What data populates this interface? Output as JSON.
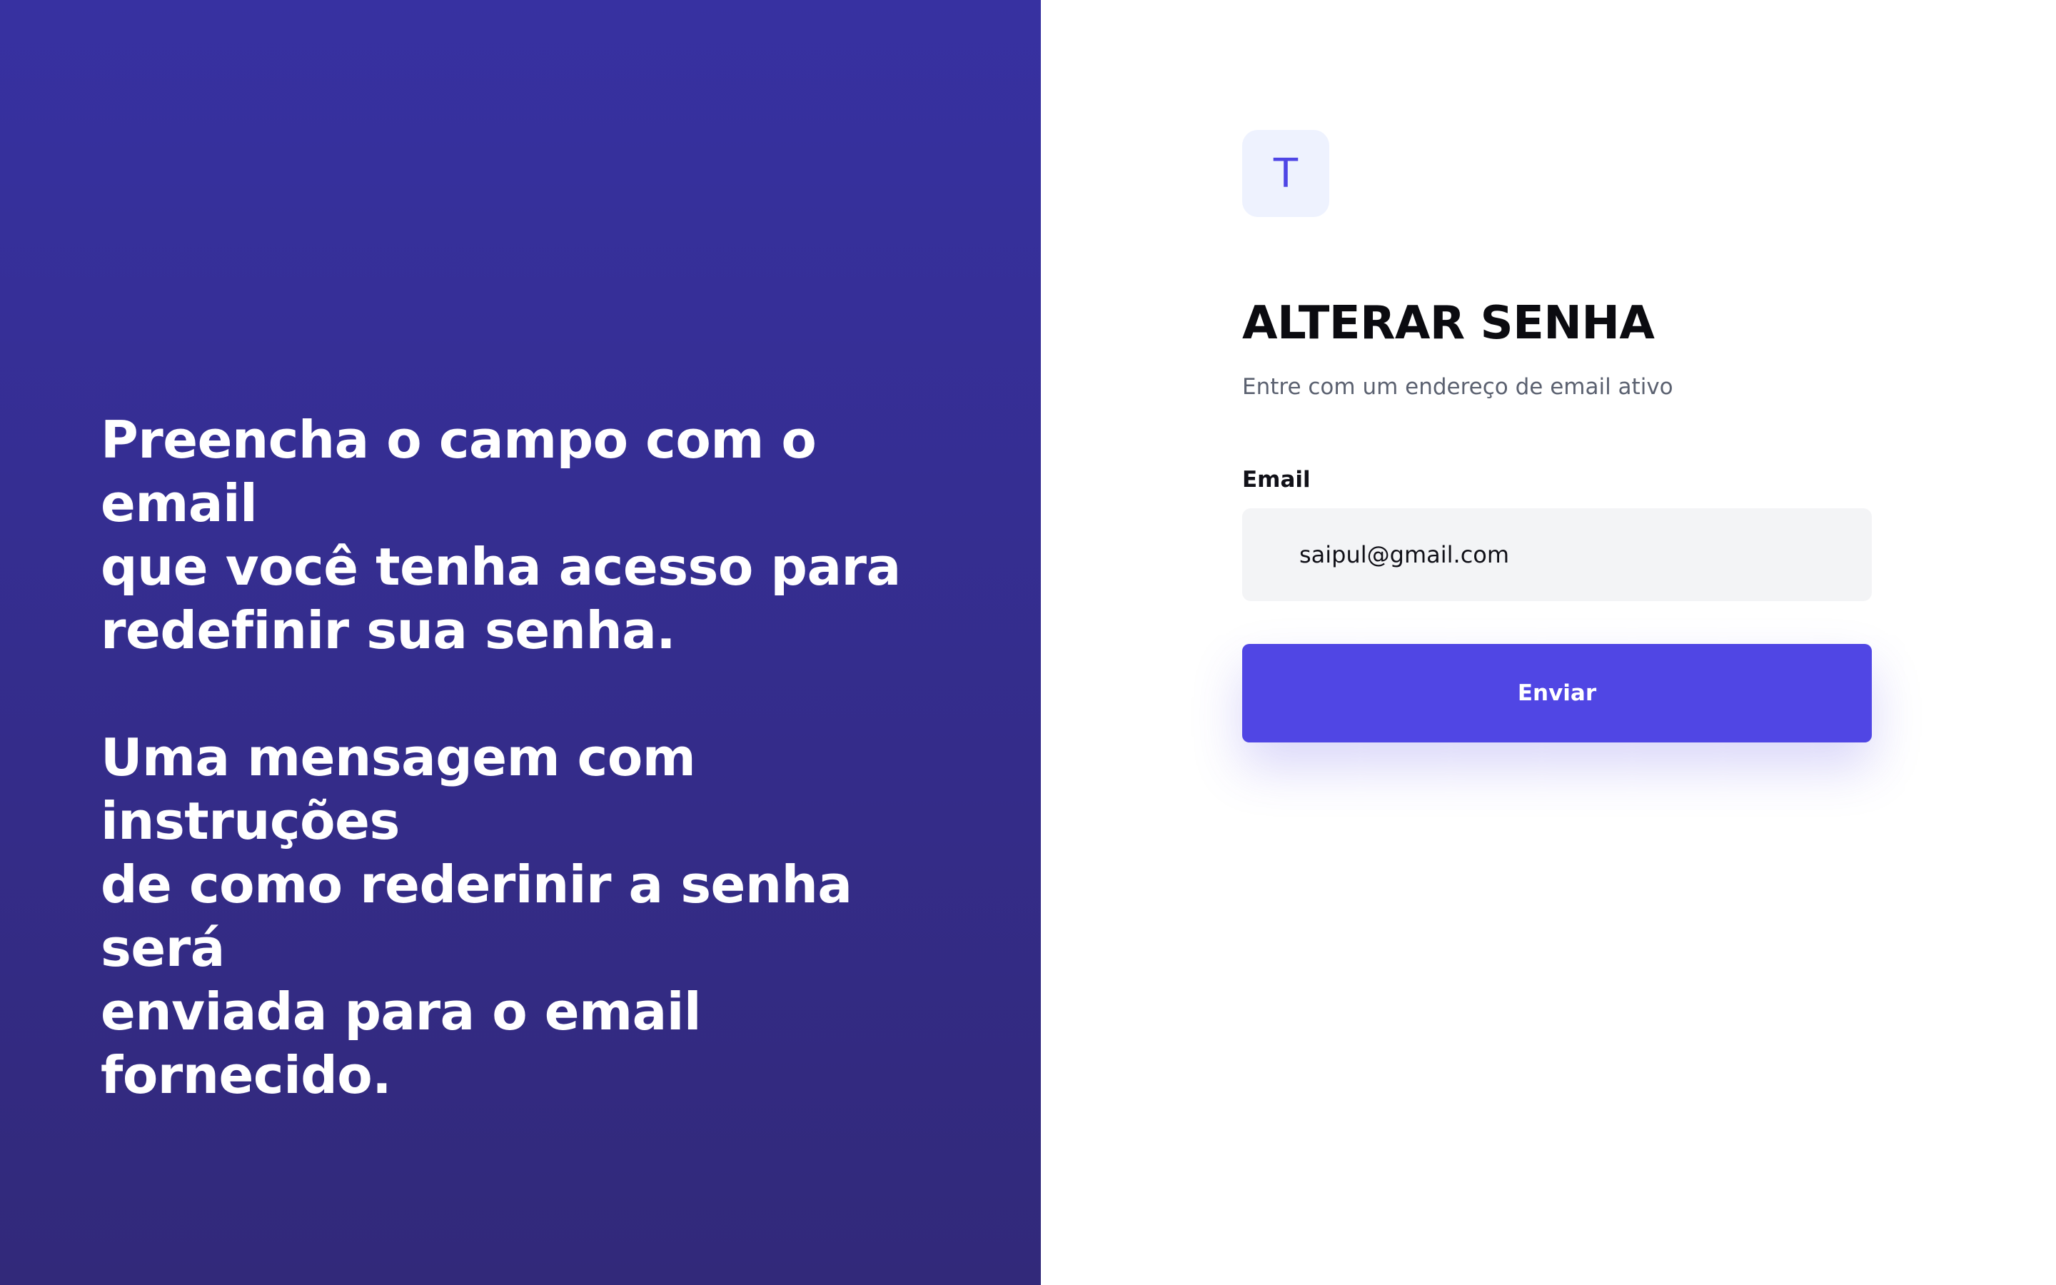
{
  "left_panel": {
    "paragraph_1": "Preencha o campo com o email\nque você tenha acesso  para\nredefinir sua senha.",
    "paragraph_2": "Uma mensagem com instruções\nde como rederinir a senha será\nenviada para o email fornecido."
  },
  "logo": {
    "letter": "T"
  },
  "form": {
    "title": "ALTERAR SENHA",
    "subtitle": "Entre com um endereço de email ativo",
    "email_label": "Email",
    "email_value": "saipul@gmail.com",
    "submit_label": "Enviar"
  },
  "colors": {
    "left_gradient_top": "#3731a1",
    "left_gradient_bottom": "#32297a",
    "accent": "#5046e4",
    "logo_background": "#eef2fe",
    "input_background": "#f3f4f6"
  }
}
